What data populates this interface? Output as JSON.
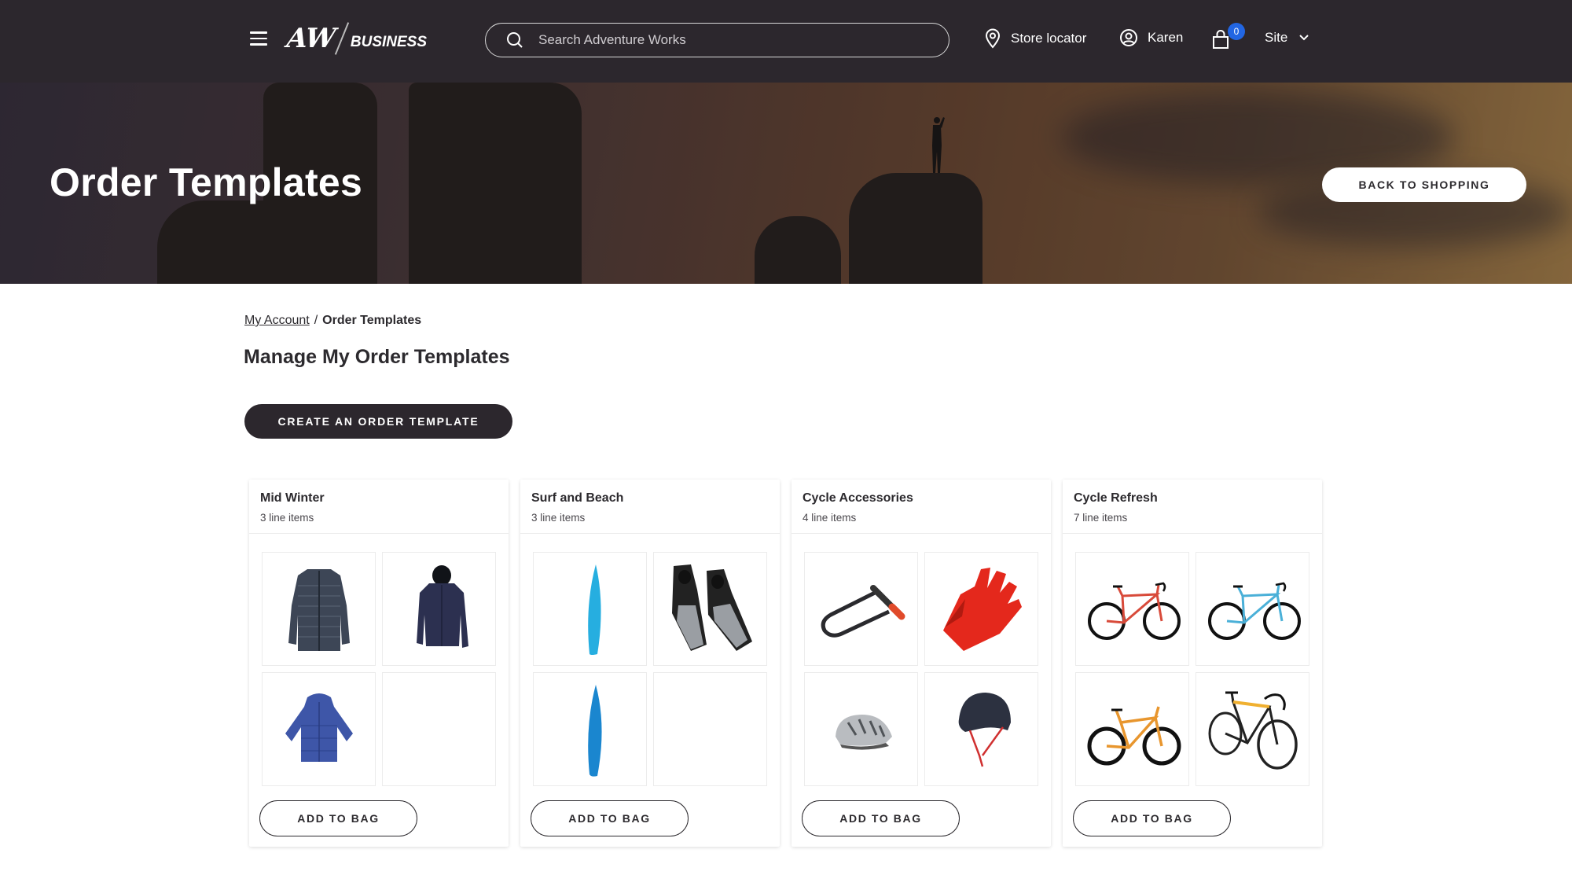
{
  "header": {
    "logo_main": "AW",
    "logo_sub": "BUSINESS",
    "search_placeholder": "Search Adventure Works",
    "store_locator": "Store locator",
    "user_name": "Karen",
    "bag_count": "0",
    "site_label": "Site",
    "badge_color": "#2266e3"
  },
  "hero": {
    "title": "Order Templates",
    "back_button": "BACK TO SHOPPING"
  },
  "breadcrumb": {
    "parent": "My Account",
    "separator": "/",
    "current": "Order Templates"
  },
  "main": {
    "heading": "Manage My Order Templates",
    "create_button": "CREATE AN ORDER TEMPLATE"
  },
  "templates": [
    {
      "name": "Mid Winter",
      "line_items": "3 line items",
      "button": "ADD TO BAG",
      "products": [
        "puffer-jacket-navy",
        "hooded-jacket-navy",
        "kids-parka-blue",
        "empty"
      ]
    },
    {
      "name": "Surf and Beach",
      "line_items": "3 line items",
      "button": "ADD TO BAG",
      "products": [
        "surfboard-light-blue",
        "swim-fins-black-grey",
        "surfboard-blue",
        "empty"
      ]
    },
    {
      "name": "Cycle Accessories",
      "line_items": "4 line items",
      "button": "ADD TO BAG",
      "products": [
        "u-lock-black",
        "cycling-glove-red",
        "bike-helmet-silver",
        "skate-helmet-black"
      ]
    },
    {
      "name": "Cycle Refresh",
      "line_items": "7 line items",
      "button": "ADD TO BAG",
      "products": [
        "road-bike-red",
        "road-bike-blue",
        "mountain-bike-orange",
        "road-bike-yellow"
      ]
    }
  ]
}
